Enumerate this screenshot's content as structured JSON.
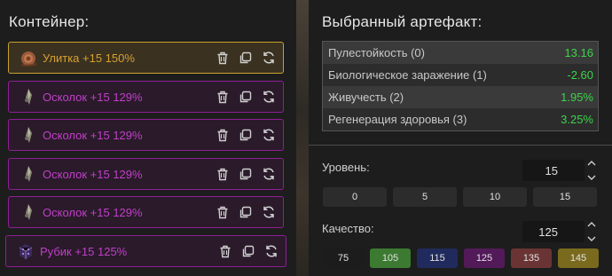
{
  "container": {
    "title": "Контейнер:",
    "items": [
      {
        "name": "Улитка +15 150%",
        "icon": "snail-icon"
      },
      {
        "name": "Осколок +15 129%",
        "icon": "shard-icon"
      },
      {
        "name": "Осколок +15 129%",
        "icon": "shard-icon"
      },
      {
        "name": "Осколок +15 129%",
        "icon": "shard-icon"
      },
      {
        "name": "Осколок +15 129%",
        "icon": "shard-icon"
      },
      {
        "name": "Рубик +15 125%",
        "icon": "rubik-icon"
      }
    ]
  },
  "artifact": {
    "title": "Выбранный артефакт:",
    "stats": [
      {
        "label": "Пулестойкость (0)",
        "value": "13.16"
      },
      {
        "label": "Биологическое заражение (1)",
        "value": "-2.60"
      },
      {
        "label": "Живучесть (2)",
        "value": "1.95%"
      },
      {
        "label": "Регенерация здоровья (3)",
        "value": "3.25%"
      }
    ]
  },
  "level": {
    "label": "Уровень:",
    "value": "15",
    "presets": [
      "0",
      "5",
      "10",
      "15"
    ]
  },
  "quality": {
    "label": "Качество:",
    "value": "125",
    "presets": [
      {
        "label": "75",
        "color": "#1c1c1c"
      },
      {
        "label": "105",
        "color": "#3c7a32"
      },
      {
        "label": "115",
        "color": "#202a5c"
      },
      {
        "label": "125",
        "color": "#531a5a"
      },
      {
        "label": "135",
        "color": "#6b3434"
      },
      {
        "label": "145",
        "color": "#7a6a1e"
      }
    ]
  },
  "colors": {
    "legendary": "#d7a12e",
    "epic": "#c13fc9",
    "positive": "#3cd44a"
  }
}
